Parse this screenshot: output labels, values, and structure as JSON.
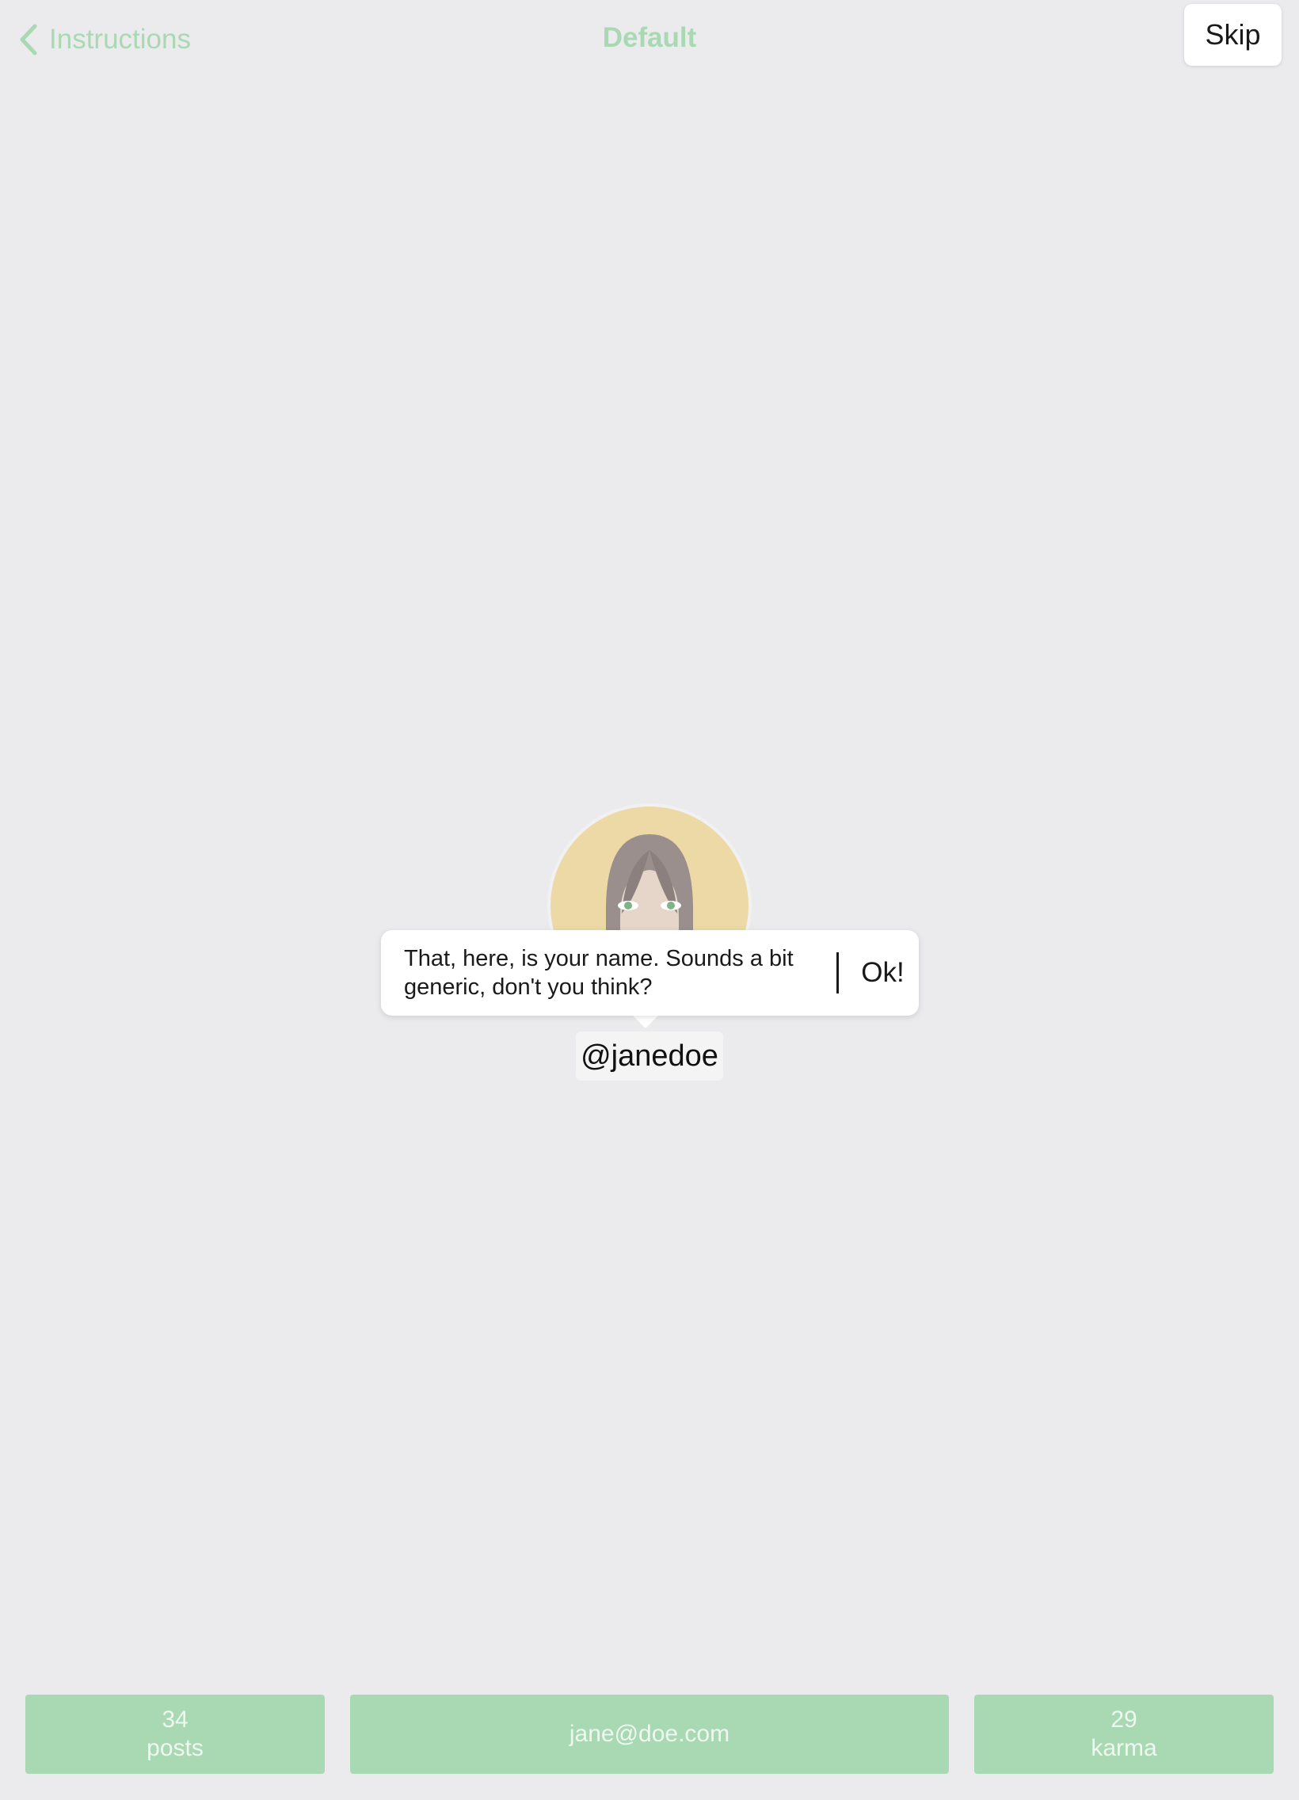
{
  "nav": {
    "back_label": "Instructions",
    "title": "Default",
    "skip_label": "Skip"
  },
  "tooltip": {
    "line1": "That, here, is your name. Sounds a bit",
    "line2": "generic, don't you think?",
    "ok_label": "Ok!"
  },
  "profile": {
    "username": "@janedoe",
    "avatar_icon": "avatar-woman-icon"
  },
  "stats": {
    "posts_count": "34",
    "posts_label": "posts",
    "email": "jane@doe.com",
    "karma_count": "29",
    "karma_label": "karma"
  },
  "colors": {
    "background": "#ebebed",
    "accent": "#a9d9b3",
    "avatar_bg": "#edd9a5"
  }
}
